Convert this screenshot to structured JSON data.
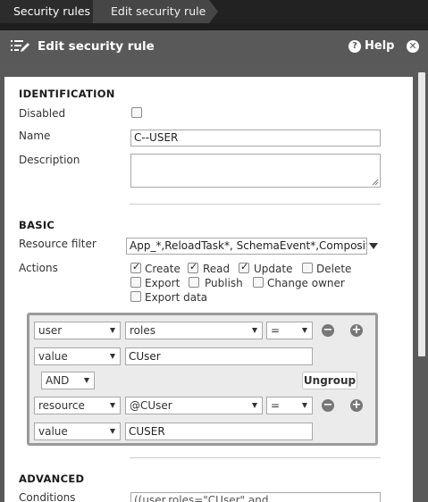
{
  "breadcrumb": {
    "items": [
      {
        "label": "Security rules"
      },
      {
        "label": "Edit security rule"
      }
    ]
  },
  "header": {
    "title": "Edit security rule",
    "icon": "edit-list-icon",
    "help_label": "Help",
    "help_icon": "help-circle-icon",
    "close_icon": "close-circle-icon"
  },
  "identification": {
    "title": "IDENTIFICATION",
    "disabled_label": "Disabled",
    "disabled_checked": false,
    "name_label": "Name",
    "name_value": "C--USER",
    "description_label": "Description",
    "description_value": ""
  },
  "basic": {
    "title": "BASIC",
    "resource_filter_label": "Resource filter",
    "resource_filter_value": "App_*,ReloadTask*, SchemaEvent*,Composit",
    "actions_label": "Actions",
    "actions": [
      {
        "label": "Create",
        "checked": true
      },
      {
        "label": "Read",
        "checked": true
      },
      {
        "label": "Update",
        "checked": true
      },
      {
        "label": "Delete",
        "checked": false
      },
      {
        "label": "Export",
        "checked": false
      },
      {
        "label": "Publish",
        "checked": false
      },
      {
        "label": "Change owner",
        "checked": false
      },
      {
        "label": "Export data",
        "checked": false
      }
    ]
  },
  "rule_builder": {
    "row1": {
      "type": "user",
      "property": "roles",
      "operator": "="
    },
    "row1_value": {
      "type": "value",
      "value": "CUser"
    },
    "logic_operator": "AND",
    "ungroup_label": "Ungroup",
    "row2": {
      "type": "resource",
      "property": "@CUser",
      "operator": "="
    },
    "row2_value": {
      "type": "value",
      "value": "CUSER"
    },
    "remove_symbol": "−",
    "add_symbol": "+"
  },
  "advanced": {
    "title": "ADVANCED",
    "conditions_label": "Conditions",
    "conditions_value": "((user.roles=\"CUser\" and"
  },
  "colors": {
    "header_bg": "#595959",
    "panel_bg": "#5a5a5a",
    "builder_border": "#9a9a9a",
    "builder_bg": "#ebebeb"
  }
}
